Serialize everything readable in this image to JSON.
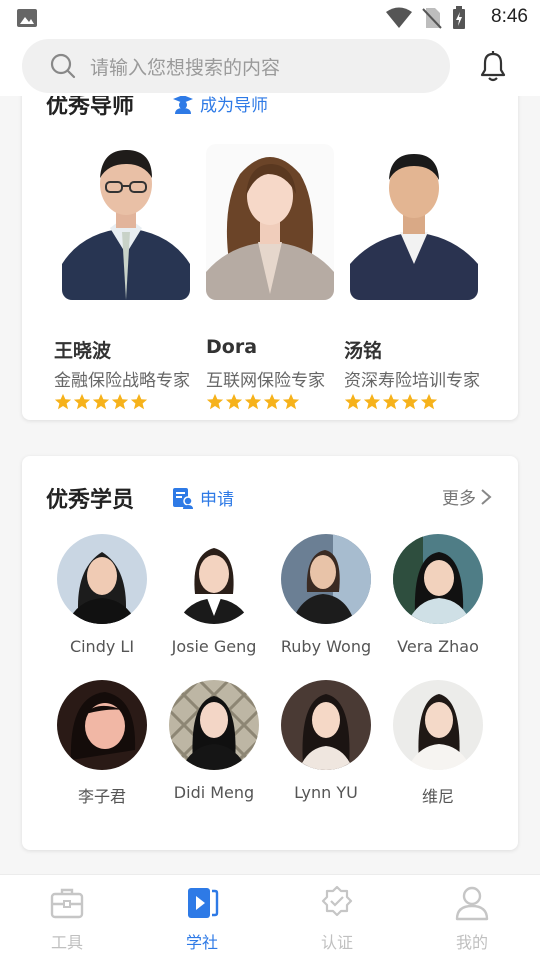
{
  "status_bar": {
    "time": "8:46"
  },
  "search": {
    "placeholder": "请输入您想搜索的内容"
  },
  "mentors_section": {
    "title": "优秀导师",
    "action_label": "成为导师",
    "items": [
      {
        "name": "王晓波",
        "title": "金融保险战略专家",
        "rating": 5
      },
      {
        "name": "Dora",
        "title": "互联网保险专家",
        "rating": 5
      },
      {
        "name": "汤铭",
        "title": "资深寿险培训专家",
        "rating": 5
      }
    ]
  },
  "students_section": {
    "title": "优秀学员",
    "action_label": "申请",
    "more_label": "更多",
    "items": [
      {
        "name": "Cindy LI"
      },
      {
        "name": "Josie Geng"
      },
      {
        "name": "Ruby Wong"
      },
      {
        "name": "Vera Zhao"
      },
      {
        "name": "李子君"
      },
      {
        "name": "Didi Meng"
      },
      {
        "name": "Lynn YU"
      },
      {
        "name": "维尼"
      }
    ]
  },
  "tabbar": {
    "items": [
      {
        "label": "工具",
        "icon": "toolbox-icon",
        "active": false
      },
      {
        "label": "学社",
        "icon": "video-book-icon",
        "active": true
      },
      {
        "label": "认证",
        "icon": "badge-check-icon",
        "active": false
      },
      {
        "label": "我的",
        "icon": "person-icon",
        "active": false
      }
    ]
  },
  "colors": {
    "accent": "#2e7ae6",
    "star": "#f6b21b"
  }
}
